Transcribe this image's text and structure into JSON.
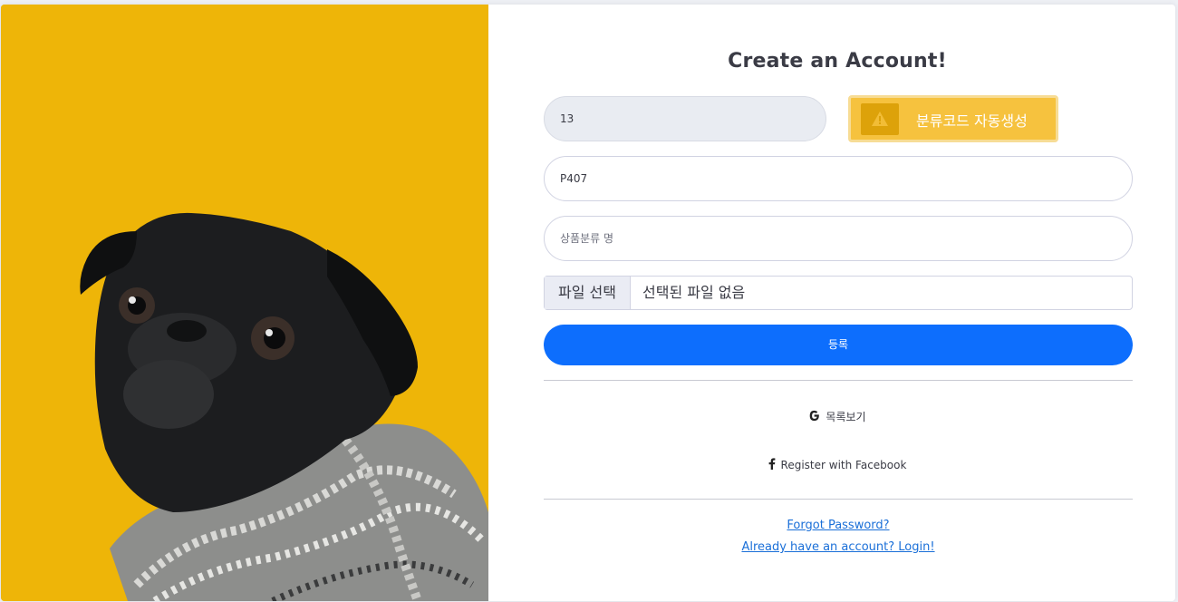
{
  "page": {
    "title": "Create an Account!"
  },
  "form": {
    "category_number_value": "13",
    "generate_button_label": "분류코드 자동생성",
    "category_code_value": "P407",
    "category_name_placeholder": "상품분류 명",
    "file_choose_label": "파일 선택",
    "file_none_text": "선택된 파일 없음",
    "submit_label": "등록"
  },
  "social": {
    "google_label": "목록보기",
    "facebook_label": "Register with Facebook"
  },
  "links": {
    "forgot_password": "Forgot Password?",
    "login": "Already have an account? Login!"
  },
  "colors": {
    "image_background": "#eeb508",
    "warning_button": "#f6c23e",
    "primary_button": "#0d6efd",
    "link": "#1a6fd8"
  },
  "icons": {
    "warning": "warning-triangle-icon",
    "google": "google-g-icon",
    "facebook": "facebook-f-icon"
  }
}
